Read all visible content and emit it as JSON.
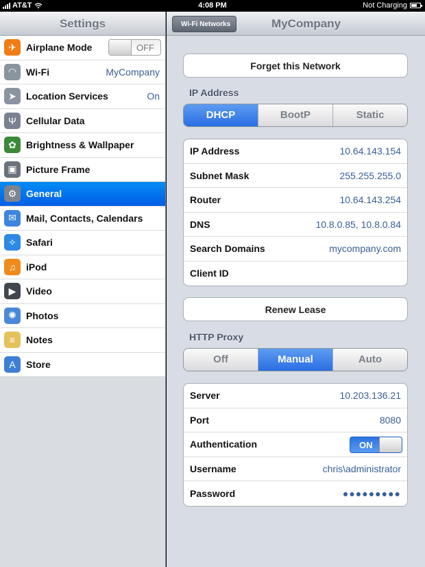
{
  "status_bar": {
    "carrier": "AT&T",
    "time": "4:08 PM",
    "battery_text": "Not Charging"
  },
  "left": {
    "title": "Settings",
    "items": [
      {
        "label": "Airplane Mode",
        "icon": "airplane-icon",
        "color": "#f07d14",
        "toggle": "OFF"
      },
      {
        "label": "Wi-Fi",
        "icon": "wifi-icon",
        "color": "#8a93a0",
        "value": "MyCompany"
      },
      {
        "label": "Location Services",
        "icon": "location-icon",
        "color": "#8a93a0",
        "value": "On"
      },
      {
        "label": "Cellular Data",
        "icon": "cellular-icon",
        "color": "#7a8292"
      },
      {
        "label": "Brightness & Wallpaper",
        "icon": "flower-icon",
        "color": "#3a8a3a"
      },
      {
        "label": "Picture Frame",
        "icon": "picture-frame-icon",
        "color": "#6c727c"
      },
      {
        "label": "General",
        "icon": "gear-icon",
        "color": "#7d848d",
        "selected": true
      },
      {
        "label": "Mail, Contacts, Calendars",
        "icon": "mail-icon",
        "color": "#3d85de"
      },
      {
        "label": "Safari",
        "icon": "compass-icon",
        "color": "#2d89e4"
      },
      {
        "label": "iPod",
        "icon": "ipod-icon",
        "color": "#f08a1c"
      },
      {
        "label": "Video",
        "icon": "clapper-icon",
        "color": "#40474f"
      },
      {
        "label": "Photos",
        "icon": "sunflower-icon",
        "color": "#4a88d8"
      },
      {
        "label": "Notes",
        "icon": "notes-icon",
        "color": "#e3c25a"
      },
      {
        "label": "Store",
        "icon": "store-icon",
        "color": "#3e7fd6"
      }
    ]
  },
  "right": {
    "back_label": "Wi-Fi Networks",
    "title": "MyCompany",
    "forget_label": "Forget this Network",
    "ip_header": "IP Address",
    "ip_segments": [
      {
        "label": "DHCP",
        "on": true
      },
      {
        "label": "BootP",
        "on": false
      },
      {
        "label": "Static",
        "on": false
      }
    ],
    "ip_rows": [
      {
        "key": "IP Address",
        "value": "10.64.143.154"
      },
      {
        "key": "Subnet Mask",
        "value": "255.255.255.0"
      },
      {
        "key": "Router",
        "value": "10.64.143.254"
      },
      {
        "key": "DNS",
        "value": "10.8.0.85, 10.8.0.84"
      },
      {
        "key": "Search Domains",
        "value": "mycompany.com"
      },
      {
        "key": "Client ID",
        "value": ""
      }
    ],
    "renew_label": "Renew Lease",
    "proxy_header": "HTTP Proxy",
    "proxy_segments": [
      {
        "label": "Off",
        "on": false
      },
      {
        "label": "Manual",
        "on": true
      },
      {
        "label": "Auto",
        "on": false
      }
    ],
    "proxy_rows": [
      {
        "key": "Server",
        "value": "10.203.136.21"
      },
      {
        "key": "Port",
        "value": "8080"
      },
      {
        "key": "Authentication",
        "toggle": "ON"
      },
      {
        "key": "Username",
        "value": "chris\\administrator"
      },
      {
        "key": "Password",
        "value": "●●●●●●●●●"
      }
    ]
  }
}
